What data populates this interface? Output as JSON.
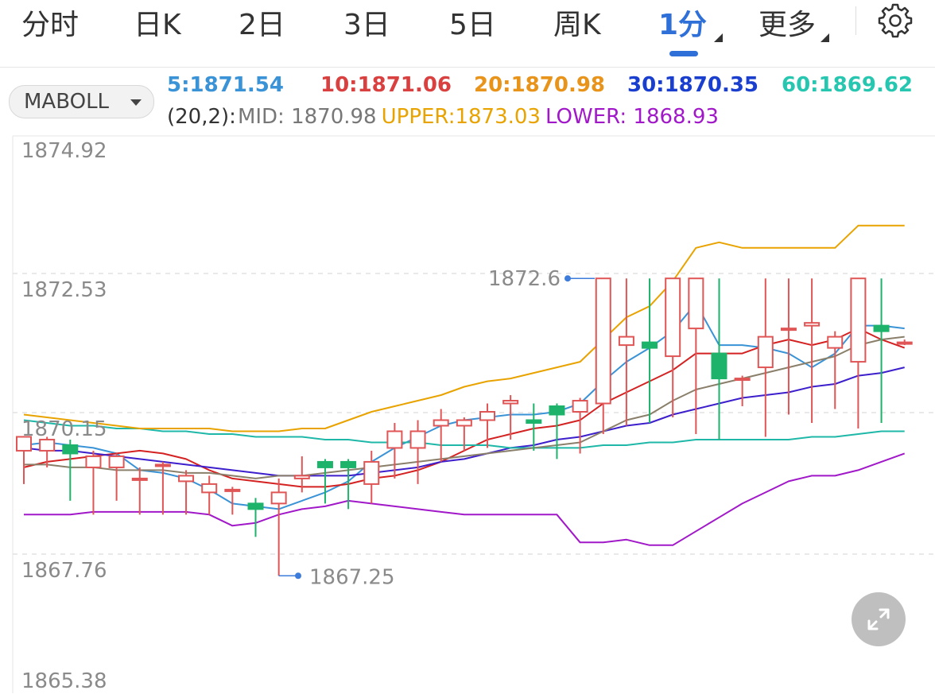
{
  "tabs": [
    "分时",
    "日K",
    "2日",
    "3日",
    "5日",
    "周K",
    "1分",
    "更多"
  ],
  "active_tab": "1分",
  "indicator_select": "MABOLL",
  "ma_values": {
    "ma5": "5:1871.54",
    "ma10": "10:1871.06",
    "ma20": "20:1870.98",
    "ma30": "30:1870.35",
    "ma60": "60:1869.62"
  },
  "boll": {
    "param": "(20,2):",
    "mid": "MID: 1870.98",
    "upper": "UPPER:1873.03",
    "lower": "LOWER: 1868.93"
  },
  "colors": {
    "up": "#e05555",
    "down": "#1db36b",
    "ma5": "#3a93d6",
    "ma10": "#d42222",
    "ma20": "#e8a300",
    "ma30": "#3d1fcc",
    "ma60": "#1fb8a8",
    "mid": "#8a7f6a",
    "upper": "#e8a300",
    "lower": "#a118c9",
    "active_tab": "#2f6fd8"
  },
  "chart_data": {
    "type": "candlestick",
    "y_ticks": [
      "1874.92",
      "1872.53",
      "1870.15",
      "1867.76",
      "1865.38"
    ],
    "ylim": [
      1865.38,
      1874.92
    ],
    "max_label": "1872.6",
    "min_label": "1867.25",
    "candles": [
      {
        "o": 1869.5,
        "c": 1869.75,
        "h": 1869.75,
        "l": 1868.9
      },
      {
        "o": 1869.5,
        "c": 1869.7,
        "h": 1869.75,
        "l": 1869.2
      },
      {
        "o": 1869.6,
        "c": 1869.45,
        "h": 1869.7,
        "l": 1868.6
      },
      {
        "o": 1869.2,
        "c": 1869.4,
        "h": 1869.5,
        "l": 1868.35
      },
      {
        "o": 1869.2,
        "c": 1869.4,
        "h": 1869.45,
        "l": 1868.6
      },
      {
        "o": 1869.0,
        "c": 1869.0,
        "h": 1869.2,
        "l": 1868.35
      },
      {
        "o": 1869.25,
        "c": 1869.25,
        "h": 1869.3,
        "l": 1868.35
      },
      {
        "o": 1868.95,
        "c": 1869.05,
        "h": 1869.15,
        "l": 1868.35
      },
      {
        "o": 1868.75,
        "c": 1868.9,
        "h": 1869.05,
        "l": 1868.35
      },
      {
        "o": 1868.8,
        "c": 1868.8,
        "h": 1868.85,
        "l": 1868.35
      },
      {
        "o": 1868.55,
        "c": 1868.45,
        "h": 1868.65,
        "l": 1867.95
      },
      {
        "o": 1868.55,
        "c": 1868.75,
        "h": 1869.0,
        "l": 1867.25
      },
      {
        "o": 1869.0,
        "c": 1869.05,
        "h": 1869.4,
        "l": 1868.75
      },
      {
        "o": 1869.3,
        "c": 1869.2,
        "h": 1869.35,
        "l": 1868.55
      },
      {
        "o": 1869.3,
        "c": 1869.2,
        "h": 1869.35,
        "l": 1868.45
      },
      {
        "o": 1868.9,
        "c": 1869.3,
        "h": 1869.5,
        "l": 1868.55
      },
      {
        "o": 1869.55,
        "c": 1869.85,
        "h": 1870.0,
        "l": 1869.0
      },
      {
        "o": 1869.55,
        "c": 1869.85,
        "h": 1870.05,
        "l": 1868.9
      },
      {
        "o": 1869.95,
        "c": 1870.05,
        "h": 1870.25,
        "l": 1869.3
      },
      {
        "o": 1869.95,
        "c": 1870.05,
        "h": 1870.1,
        "l": 1869.5
      },
      {
        "o": 1870.05,
        "c": 1870.2,
        "h": 1870.35,
        "l": 1869.55
      },
      {
        "o": 1870.35,
        "c": 1870.4,
        "h": 1870.5,
        "l": 1869.7
      },
      {
        "o": 1870.05,
        "c": 1870.0,
        "h": 1870.35,
        "l": 1869.5
      },
      {
        "o": 1870.3,
        "c": 1870.15,
        "h": 1870.35,
        "l": 1869.35
      },
      {
        "o": 1870.2,
        "c": 1870.4,
        "h": 1870.45,
        "l": 1869.45
      },
      {
        "o": 1870.35,
        "c": 1872.6,
        "h": 1872.6,
        "l": 1869.8
      },
      {
        "o": 1871.4,
        "c": 1871.55,
        "h": 1872.6,
        "l": 1869.95
      },
      {
        "o": 1871.45,
        "c": 1871.35,
        "h": 1872.6,
        "l": 1870.0
      },
      {
        "o": 1871.2,
        "c": 1872.6,
        "h": 1872.6,
        "l": 1870.1
      },
      {
        "o": 1871.7,
        "c": 1872.6,
        "h": 1872.6,
        "l": 1869.8
      },
      {
        "o": 1871.25,
        "c": 1870.8,
        "h": 1872.6,
        "l": 1869.7
      },
      {
        "o": 1870.8,
        "c": 1870.8,
        "h": 1870.85,
        "l": 1870.3
      },
      {
        "o": 1871.0,
        "c": 1871.55,
        "h": 1872.6,
        "l": 1869.75
      },
      {
        "o": 1871.7,
        "c": 1871.7,
        "h": 1872.6,
        "l": 1870.15
      },
      {
        "o": 1871.75,
        "c": 1871.8,
        "h": 1872.6,
        "l": 1870.0
      },
      {
        "o": 1871.35,
        "c": 1871.55,
        "h": 1871.65,
        "l": 1870.25
      },
      {
        "o": 1871.1,
        "c": 1872.6,
        "h": 1872.6,
        "l": 1869.9
      },
      {
        "o": 1871.75,
        "c": 1871.65,
        "h": 1872.6,
        "l": 1870.0
      },
      {
        "o": 1871.45,
        "c": 1871.45,
        "h": 1871.5,
        "l": 1871.4
      }
    ],
    "series": [
      {
        "name": "5",
        "values": [
          1869.6,
          1869.65,
          1869.6,
          1869.55,
          1869.45,
          1869.15,
          1869.1,
          1869.0,
          1868.8,
          1868.55,
          1868.5,
          1868.45,
          1868.6,
          1868.75,
          1868.95,
          1869.3,
          1869.55,
          1869.75,
          1869.95,
          1870.05,
          1870.1,
          1870.15,
          1870.15,
          1870.2,
          1870.35,
          1870.75,
          1871.1,
          1871.35,
          1871.65,
          1872.15,
          1871.4,
          1871.4,
          1871.35,
          1871.25,
          1871.0,
          1871.25,
          1871.75,
          1871.75,
          1871.7
        ]
      },
      {
        "name": "10",
        "values": [
          1869.2,
          1869.3,
          1869.35,
          1869.4,
          1869.45,
          1869.5,
          1869.45,
          1869.35,
          1869.15,
          1869.0,
          1868.95,
          1868.9,
          1868.85,
          1868.85,
          1868.9,
          1869.0,
          1869.05,
          1869.15,
          1869.3,
          1869.5,
          1869.7,
          1869.8,
          1869.9,
          1869.95,
          1870.05,
          1870.35,
          1870.55,
          1870.75,
          1870.95,
          1871.25,
          1871.25,
          1871.25,
          1871.4,
          1871.5,
          1871.4,
          1871.5,
          1871.7,
          1871.5,
          1871.35
        ]
      },
      {
        "name": "20",
        "values": [
          1870.15,
          1870.1,
          1870.05,
          1870.0,
          1869.95,
          1869.9,
          1869.9,
          1869.9,
          1869.9,
          1869.85,
          1869.85,
          1869.85,
          1869.9,
          1869.9,
          1870.05,
          1870.2,
          1870.3,
          1870.4,
          1870.5,
          1870.65,
          1870.75,
          1870.8,
          1870.9,
          1871.0,
          1871.1,
          1871.5,
          1871.9,
          1872.1,
          1872.55,
          1873.15,
          1873.25,
          1873.15,
          1873.15,
          1873.15,
          1873.15,
          1873.15,
          1873.55,
          1873.55,
          1873.55
        ]
      },
      {
        "name": "30",
        "values": [
          1869.55,
          1869.5,
          1869.5,
          1869.45,
          1869.4,
          1869.35,
          1869.3,
          1869.25,
          1869.2,
          1869.15,
          1869.1,
          1869.05,
          1869.05,
          1869.05,
          1869.05,
          1869.1,
          1869.15,
          1869.2,
          1869.3,
          1869.35,
          1869.45,
          1869.55,
          1869.6,
          1869.7,
          1869.75,
          1869.85,
          1869.95,
          1870.0,
          1870.15,
          1870.25,
          1870.35,
          1870.45,
          1870.5,
          1870.55,
          1870.65,
          1870.7,
          1870.85,
          1870.9,
          1871.0
        ]
      },
      {
        "name": "60",
        "values": [
          1870.05,
          1870.0,
          1869.95,
          1869.95,
          1869.9,
          1869.9,
          1869.85,
          1869.85,
          1869.8,
          1869.8,
          1869.75,
          1869.75,
          1869.75,
          1869.7,
          1869.7,
          1869.65,
          1869.65,
          1869.65,
          1869.6,
          1869.6,
          1869.6,
          1869.55,
          1869.55,
          1869.55,
          1869.55,
          1869.6,
          1869.6,
          1869.65,
          1869.65,
          1869.7,
          1869.7,
          1869.7,
          1869.7,
          1869.7,
          1869.75,
          1869.75,
          1869.8,
          1869.85,
          1869.85
        ]
      },
      {
        "name": "MID",
        "values": [
          1869.25,
          1869.25,
          1869.2,
          1869.2,
          1869.15,
          1869.15,
          1869.15,
          1869.1,
          1869.1,
          1869.05,
          1869.0,
          1869.05,
          1869.05,
          1869.1,
          1869.15,
          1869.2,
          1869.25,
          1869.3,
          1869.35,
          1869.4,
          1869.45,
          1869.5,
          1869.55,
          1869.6,
          1869.65,
          1869.85,
          1870.05,
          1870.15,
          1870.4,
          1870.6,
          1870.7,
          1870.8,
          1870.9,
          1871.0,
          1871.1,
          1871.2,
          1871.4,
          1871.5,
          1871.55
        ]
      },
      {
        "name": "UPPER",
        "values": [
          1870.15,
          1870.1,
          1870.05,
          1870.0,
          1869.95,
          1869.9,
          1869.9,
          1869.9,
          1869.9,
          1869.85,
          1869.85,
          1869.85,
          1869.9,
          1869.9,
          1870.05,
          1870.2,
          1870.3,
          1870.4,
          1870.5,
          1870.65,
          1870.75,
          1870.8,
          1870.9,
          1871.0,
          1871.1,
          1871.5,
          1871.9,
          1872.1,
          1872.55,
          1873.15,
          1873.25,
          1873.15,
          1873.15,
          1873.15,
          1873.15,
          1873.15,
          1873.55,
          1873.55,
          1873.55
        ]
      },
      {
        "name": "LOWER",
        "values": [
          1868.35,
          1868.35,
          1868.35,
          1868.4,
          1868.4,
          1868.4,
          1868.4,
          1868.4,
          1868.35,
          1868.15,
          1868.2,
          1868.35,
          1868.45,
          1868.5,
          1868.6,
          1868.55,
          1868.5,
          1868.45,
          1868.4,
          1868.35,
          1868.35,
          1868.35,
          1868.35,
          1868.35,
          1867.85,
          1867.85,
          1867.9,
          1867.8,
          1867.8,
          1868.05,
          1868.3,
          1868.55,
          1868.75,
          1868.95,
          1869.05,
          1869.05,
          1869.15,
          1869.3,
          1869.45
        ]
      }
    ]
  }
}
